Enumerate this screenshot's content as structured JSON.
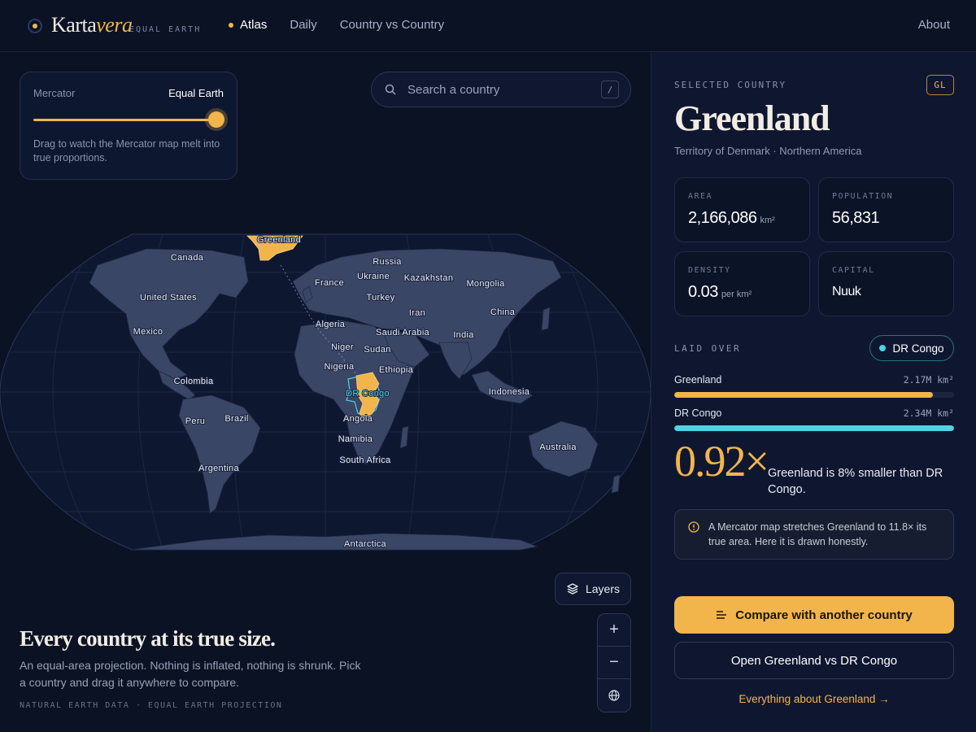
{
  "brand": {
    "name_main": "Karta",
    "name_accent": "vera",
    "subtitle": "EQUAL EARTH"
  },
  "nav": {
    "items": [
      "Atlas",
      "Daily",
      "Country vs Country"
    ],
    "active": "Atlas",
    "about": "About"
  },
  "projection": {
    "left_label": "Mercator",
    "right_label": "Equal Earth",
    "value": 1.0,
    "help": "Drag to watch the Mercator map melt into true proportions."
  },
  "search": {
    "placeholder": "Search a country",
    "shortcut": "/"
  },
  "map": {
    "labels": {
      "greenland": "Greenland",
      "canada": "Canada",
      "usa": "United States",
      "mexico": "Mexico",
      "colombia": "Colombia",
      "peru": "Peru",
      "brazil": "Brazil",
      "argentina": "Argentina",
      "russia": "Russia",
      "france": "France",
      "ukraine": "Ukraine",
      "kazakhstan": "Kazakhstan",
      "mongolia": "Mongolia",
      "turkey": "Turkey",
      "iran": "Iran",
      "china": "China",
      "algeria": "Algeria",
      "saudi": "Saudi Arabia",
      "india": "India",
      "niger": "Niger",
      "sudan": "Sudan",
      "nigeria": "Nigeria",
      "ethiopia": "Ethiopia",
      "drcongo": "DR Congo",
      "indonesia": "Indonesia",
      "angola": "Angola",
      "namibia": "Namibia",
      "southafrica": "South Africa",
      "australia": "Australia",
      "antarctica": "Antarctica"
    },
    "highlight_color": "#f2b54c",
    "overlay_color": "#4fd1e6",
    "land_color": "#3a4665"
  },
  "layers_label": "Layers",
  "zoom": {
    "in": "+",
    "out": "−"
  },
  "intro": {
    "title": "Every country at its true size.",
    "body": "An equal-area projection. Nothing is inflated, nothing is shrunk. Pick a country and drag it anywhere to compare.",
    "credits": "NATURAL EARTH DATA · EQUAL EARTH PROJECTION"
  },
  "panel": {
    "selected_label": "SELECTED COUNTRY",
    "iso": "GL",
    "name": "Greenland",
    "meta": "Territory of Denmark · Northern America",
    "stats": {
      "area": {
        "label": "AREA",
        "value": "2,166,086",
        "unit": "km²"
      },
      "population": {
        "label": "POPULATION",
        "value": "56,831"
      },
      "density": {
        "label": "DENSITY",
        "value": "0.03",
        "unit": "per km²"
      },
      "capital": {
        "label": "CAPITAL",
        "value": "Nuuk"
      }
    },
    "laid_over_label": "LAID OVER",
    "laid_over_country": "DR Congo",
    "bars": [
      {
        "name": "Greenland",
        "value_label": "2.17M km²",
        "fraction": 0.924,
        "color": "#f2b54c"
      },
      {
        "name": "DR Congo",
        "value_label": "2.34M km²",
        "fraction": 1.0,
        "color": "#4fd1e6"
      }
    ],
    "ratio": "0.92×",
    "ratio_text": "Greenland is 8% smaller than DR Congo.",
    "note": "A Mercator map stretches Greenland to 11.8× its true area. Here it is drawn honestly.",
    "primary_button": "Compare with another country",
    "secondary_button": "Open Greenland vs DR Congo",
    "more_link": "Everything about Greenland →"
  }
}
